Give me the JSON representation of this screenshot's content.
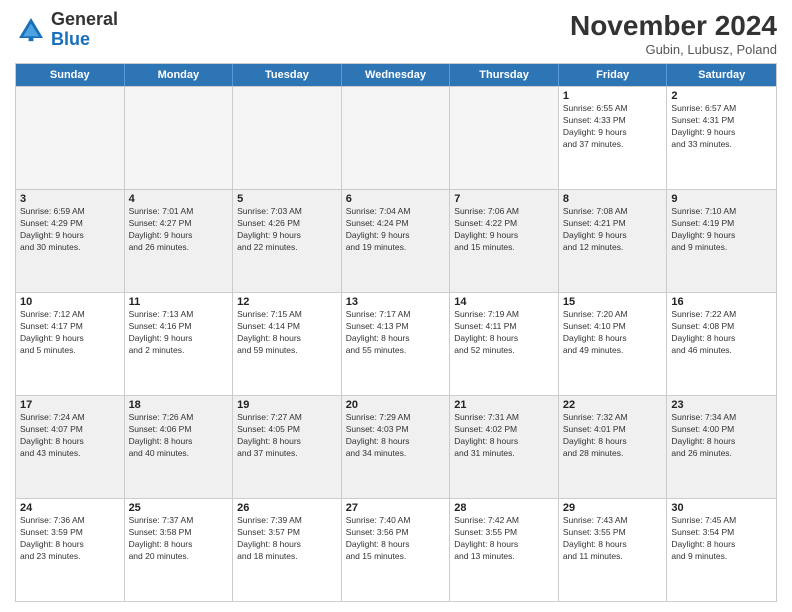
{
  "logo": {
    "general": "General",
    "blue": "Blue"
  },
  "header": {
    "title": "November 2024",
    "subtitle": "Gubin, Lubusz, Poland"
  },
  "weekdays": [
    "Sunday",
    "Monday",
    "Tuesday",
    "Wednesday",
    "Thursday",
    "Friday",
    "Saturday"
  ],
  "rows": [
    [
      {
        "day": "",
        "detail": "",
        "empty": true
      },
      {
        "day": "",
        "detail": "",
        "empty": true
      },
      {
        "day": "",
        "detail": "",
        "empty": true
      },
      {
        "day": "",
        "detail": "",
        "empty": true
      },
      {
        "day": "",
        "detail": "",
        "empty": true
      },
      {
        "day": "1",
        "detail": "Sunrise: 6:55 AM\nSunset: 4:33 PM\nDaylight: 9 hours\nand 37 minutes."
      },
      {
        "day": "2",
        "detail": "Sunrise: 6:57 AM\nSunset: 4:31 PM\nDaylight: 9 hours\nand 33 minutes."
      }
    ],
    [
      {
        "day": "3",
        "detail": "Sunrise: 6:59 AM\nSunset: 4:29 PM\nDaylight: 9 hours\nand 30 minutes."
      },
      {
        "day": "4",
        "detail": "Sunrise: 7:01 AM\nSunset: 4:27 PM\nDaylight: 9 hours\nand 26 minutes."
      },
      {
        "day": "5",
        "detail": "Sunrise: 7:03 AM\nSunset: 4:26 PM\nDaylight: 9 hours\nand 22 minutes."
      },
      {
        "day": "6",
        "detail": "Sunrise: 7:04 AM\nSunset: 4:24 PM\nDaylight: 9 hours\nand 19 minutes."
      },
      {
        "day": "7",
        "detail": "Sunrise: 7:06 AM\nSunset: 4:22 PM\nDaylight: 9 hours\nand 15 minutes."
      },
      {
        "day": "8",
        "detail": "Sunrise: 7:08 AM\nSunset: 4:21 PM\nDaylight: 9 hours\nand 12 minutes."
      },
      {
        "day": "9",
        "detail": "Sunrise: 7:10 AM\nSunset: 4:19 PM\nDaylight: 9 hours\nand 9 minutes."
      }
    ],
    [
      {
        "day": "10",
        "detail": "Sunrise: 7:12 AM\nSunset: 4:17 PM\nDaylight: 9 hours\nand 5 minutes."
      },
      {
        "day": "11",
        "detail": "Sunrise: 7:13 AM\nSunset: 4:16 PM\nDaylight: 9 hours\nand 2 minutes."
      },
      {
        "day": "12",
        "detail": "Sunrise: 7:15 AM\nSunset: 4:14 PM\nDaylight: 8 hours\nand 59 minutes."
      },
      {
        "day": "13",
        "detail": "Sunrise: 7:17 AM\nSunset: 4:13 PM\nDaylight: 8 hours\nand 55 minutes."
      },
      {
        "day": "14",
        "detail": "Sunrise: 7:19 AM\nSunset: 4:11 PM\nDaylight: 8 hours\nand 52 minutes."
      },
      {
        "day": "15",
        "detail": "Sunrise: 7:20 AM\nSunset: 4:10 PM\nDaylight: 8 hours\nand 49 minutes."
      },
      {
        "day": "16",
        "detail": "Sunrise: 7:22 AM\nSunset: 4:08 PM\nDaylight: 8 hours\nand 46 minutes."
      }
    ],
    [
      {
        "day": "17",
        "detail": "Sunrise: 7:24 AM\nSunset: 4:07 PM\nDaylight: 8 hours\nand 43 minutes."
      },
      {
        "day": "18",
        "detail": "Sunrise: 7:26 AM\nSunset: 4:06 PM\nDaylight: 8 hours\nand 40 minutes."
      },
      {
        "day": "19",
        "detail": "Sunrise: 7:27 AM\nSunset: 4:05 PM\nDaylight: 8 hours\nand 37 minutes."
      },
      {
        "day": "20",
        "detail": "Sunrise: 7:29 AM\nSunset: 4:03 PM\nDaylight: 8 hours\nand 34 minutes."
      },
      {
        "day": "21",
        "detail": "Sunrise: 7:31 AM\nSunset: 4:02 PM\nDaylight: 8 hours\nand 31 minutes."
      },
      {
        "day": "22",
        "detail": "Sunrise: 7:32 AM\nSunset: 4:01 PM\nDaylight: 8 hours\nand 28 minutes."
      },
      {
        "day": "23",
        "detail": "Sunrise: 7:34 AM\nSunset: 4:00 PM\nDaylight: 8 hours\nand 26 minutes."
      }
    ],
    [
      {
        "day": "24",
        "detail": "Sunrise: 7:36 AM\nSunset: 3:59 PM\nDaylight: 8 hours\nand 23 minutes."
      },
      {
        "day": "25",
        "detail": "Sunrise: 7:37 AM\nSunset: 3:58 PM\nDaylight: 8 hours\nand 20 minutes."
      },
      {
        "day": "26",
        "detail": "Sunrise: 7:39 AM\nSunset: 3:57 PM\nDaylight: 8 hours\nand 18 minutes."
      },
      {
        "day": "27",
        "detail": "Sunrise: 7:40 AM\nSunset: 3:56 PM\nDaylight: 8 hours\nand 15 minutes."
      },
      {
        "day": "28",
        "detail": "Sunrise: 7:42 AM\nSunset: 3:55 PM\nDaylight: 8 hours\nand 13 minutes."
      },
      {
        "day": "29",
        "detail": "Sunrise: 7:43 AM\nSunset: 3:55 PM\nDaylight: 8 hours\nand 11 minutes."
      },
      {
        "day": "30",
        "detail": "Sunrise: 7:45 AM\nSunset: 3:54 PM\nDaylight: 8 hours\nand 9 minutes."
      }
    ]
  ]
}
